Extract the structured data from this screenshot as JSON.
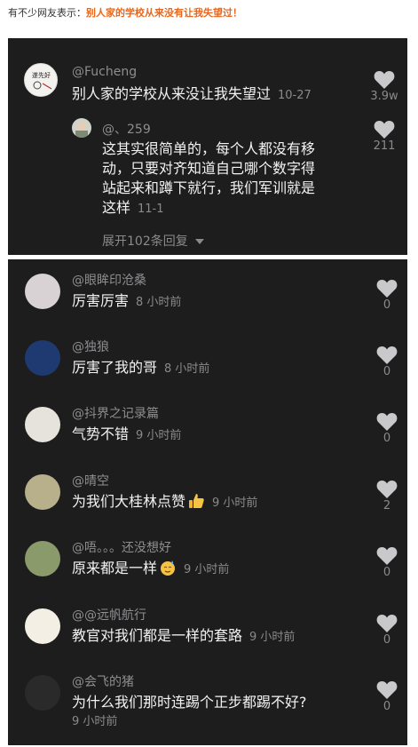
{
  "intro": {
    "prefix": "有不少网友表示：",
    "highlight": "别人家的学校从来没有让我失望过！"
  },
  "thread": {
    "top": {
      "user": "@Fucheng",
      "text": "别人家的学校从来没让我失望过",
      "time": "10-27",
      "likes": "3.9w",
      "avatar_text": "遂先好"
    },
    "reply": {
      "user": "@、259",
      "lines": [
        "这其实很简单的，每个人都没有移",
        "动，只要对齐知道自己哪个数字得",
        "站起来和蹲下就行，我们军训就是"
      ],
      "last_line": "这样",
      "time": "11-1",
      "likes": "211"
    },
    "expand_label": "展开102条回复",
    "expand_icon": "caret-down-icon"
  },
  "comments": [
    {
      "user": "@眼眸印沧桑",
      "text": "厉害厉害",
      "time": "8 小时前",
      "likes": "0"
    },
    {
      "user": "@独狼",
      "text": "厉害了我的哥",
      "time": "8 小时前",
      "likes": "0"
    },
    {
      "user": "@抖界之记录篇",
      "text": "气势不错",
      "time": "9 小时前",
      "likes": "0"
    },
    {
      "user": "@晴空",
      "text": "为我们大桂林点赞",
      "emoji": "thumbs-up-icon",
      "time": "9 小时前",
      "likes": "2"
    },
    {
      "user": "@唔。。。还没想好",
      "text": "原来都是一样",
      "emoji": "sweat-smile-icon",
      "time": "9 小时前",
      "likes": "0"
    },
    {
      "user": "@@远帆航行",
      "text": "教官对我们都是一样的套路",
      "time": "9 小时前",
      "likes": "0"
    },
    {
      "user": "@会飞的猪",
      "text": "为什么我们那时连踢个正步都踢不好?",
      "time": "9 小时前",
      "likes": "0"
    }
  ],
  "colors": {
    "panel_bg": "#1d1d1e",
    "highlight": "#e8671c",
    "heart": "#c9c9cb",
    "meta": "#8a8a8c"
  }
}
